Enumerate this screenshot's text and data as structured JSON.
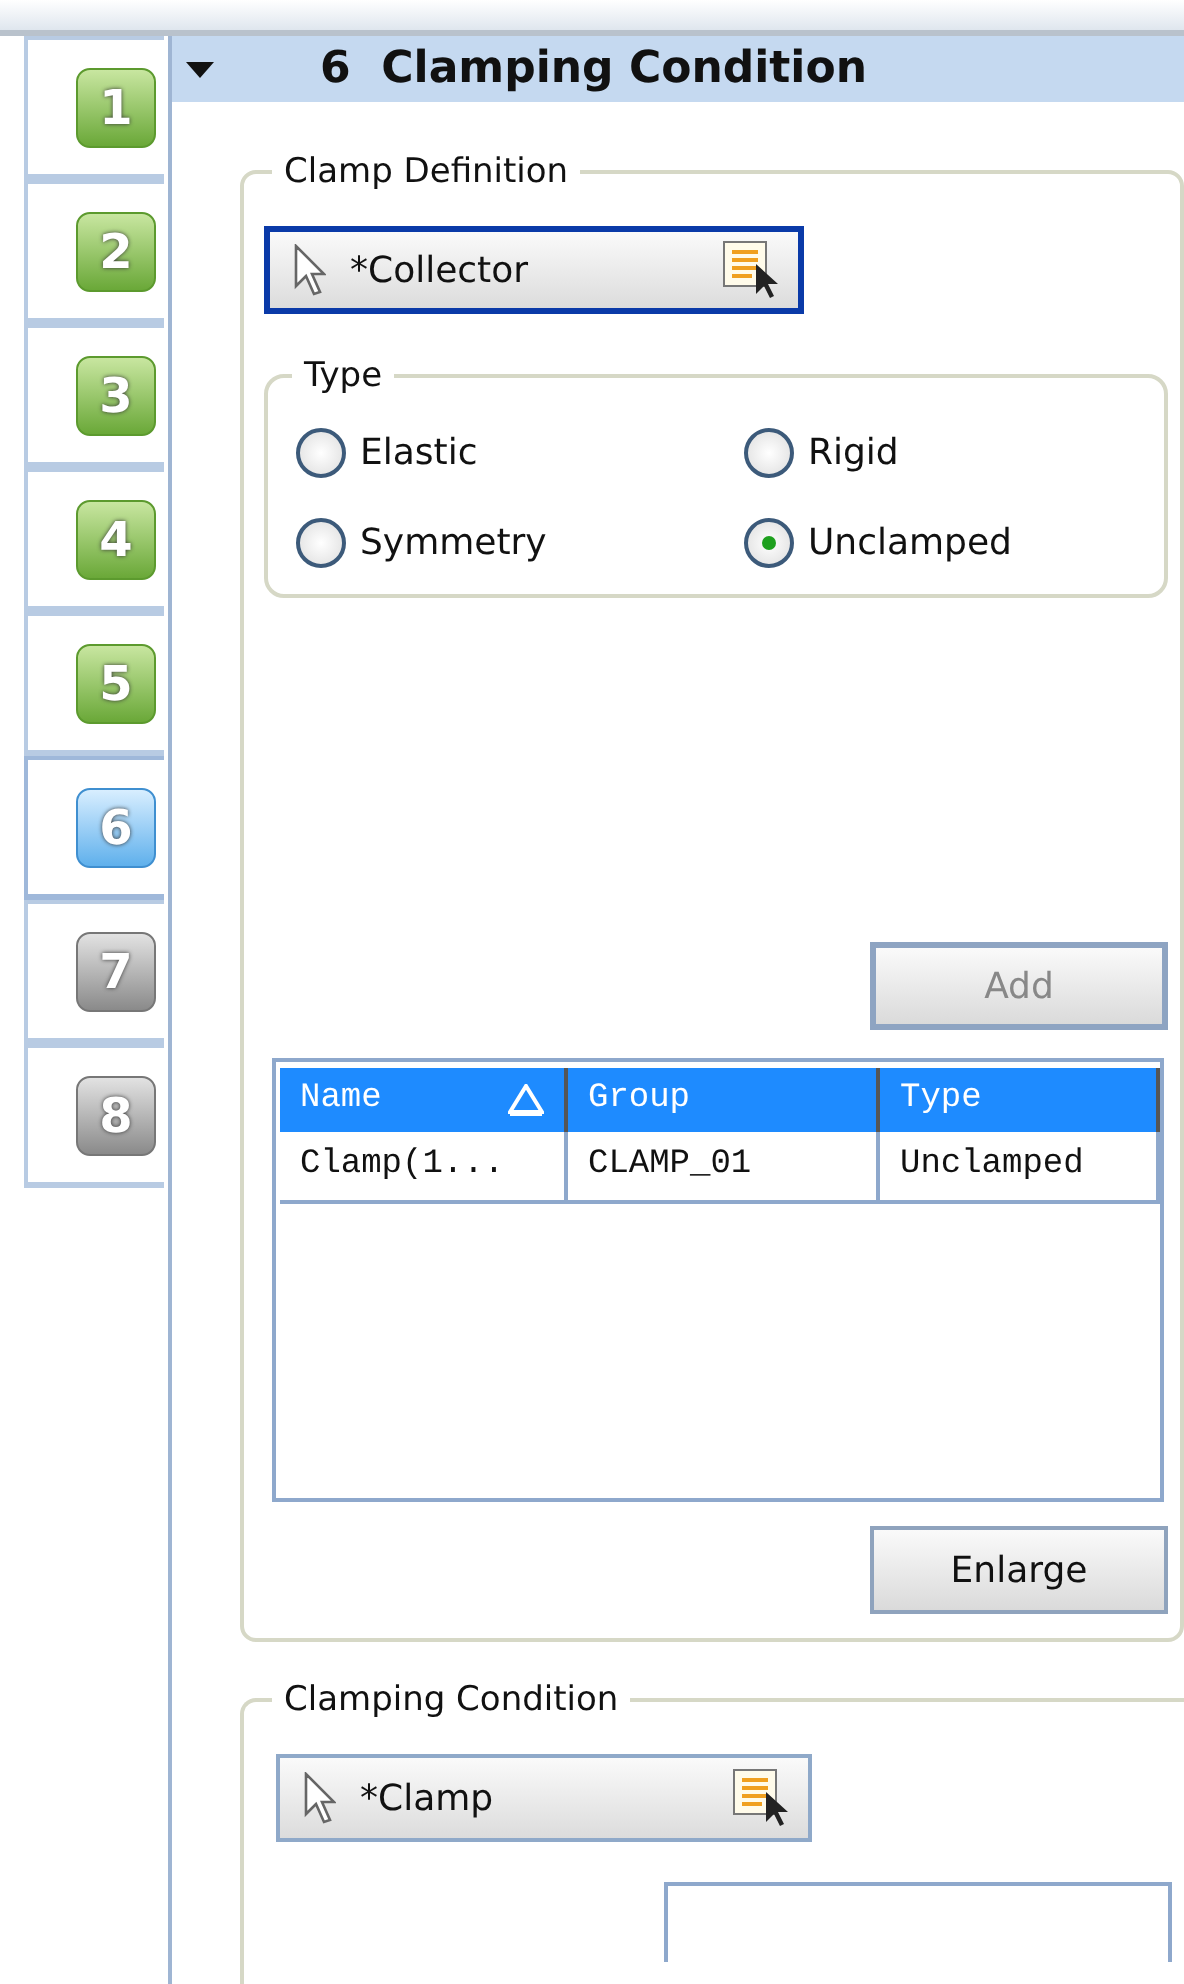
{
  "steps": [
    {
      "label": "1",
      "selected": false,
      "disabled": false
    },
    {
      "label": "2",
      "selected": false,
      "disabled": false
    },
    {
      "label": "3",
      "selected": false,
      "disabled": false
    },
    {
      "label": "4",
      "selected": false,
      "disabled": false
    },
    {
      "label": "5",
      "selected": false,
      "disabled": false
    },
    {
      "label": "6",
      "selected": true,
      "disabled": false
    },
    {
      "label": "7",
      "selected": false,
      "disabled": true
    },
    {
      "label": "8",
      "selected": false,
      "disabled": true
    }
  ],
  "header": {
    "number": "6",
    "title": "Clamping Condition",
    "expanded": true
  },
  "clamp_definition": {
    "title": "Clamp Definition",
    "collector": {
      "label": "*Collector",
      "focused": true
    },
    "type_group": {
      "title": "Type",
      "options": [
        {
          "label": "Elastic",
          "selected": false
        },
        {
          "label": "Rigid",
          "selected": false
        },
        {
          "label": "Symmetry",
          "selected": false
        },
        {
          "label": "Unclamped",
          "selected": true
        }
      ]
    },
    "add_button": {
      "label": "Add",
      "disabled": true
    },
    "table": {
      "columns": [
        {
          "label": "Name",
          "sorted": true
        },
        {
          "label": "Group",
          "sorted": false
        },
        {
          "label": "Type",
          "sorted": false
        }
      ],
      "rows": [
        [
          "Clamp(1...",
          "CLAMP_01",
          "Unclamped"
        ]
      ]
    },
    "enlarge_button": {
      "label": "Enlarge",
      "disabled": false
    }
  },
  "clamping_condition": {
    "title": "Clamping Condition",
    "collector": {
      "label": "*Clamp",
      "focused": false
    }
  }
}
